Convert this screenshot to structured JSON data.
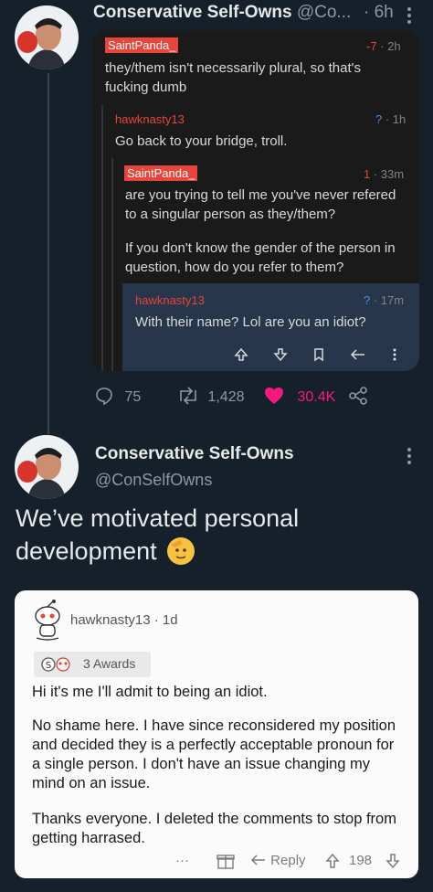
{
  "tweet1": {
    "display_name": "Conservative Self-Owns",
    "handle_truncated": "@Co...",
    "time": "· 6h",
    "avatar_icon": "profile-avatar"
  },
  "reddit_thread": {
    "comments": [
      {
        "user": "SaintPanda_",
        "score": "-7",
        "age": "· 2h",
        "text": "they/them isn't necessarily plural, so that's fucking dumb"
      },
      {
        "user": "hawknasty13",
        "score": "?",
        "age": "· 1h",
        "text": "Go back to your bridge, troll."
      },
      {
        "user": "SaintPanda_",
        "score": "1",
        "age": "· 33m",
        "text": "are you trying to tell me you've never refered to a singular person as they/them?",
        "text2": "If you don't know the gender of the person in question, how do you refer to them?"
      },
      {
        "user": "hawknasty13",
        "score": "?",
        "age": "· 17m",
        "text": "With their name? Lol are you an idiot?"
      }
    ],
    "action_icons": [
      "upvote-icon",
      "downvote-icon",
      "bookmark-icon",
      "reply-icon",
      "more-icon"
    ]
  },
  "tweet1_stats": {
    "replies": "75",
    "retweets": "1,428",
    "likes": "30.4K"
  },
  "tweet2": {
    "display_name": "Conservative Self-Owns",
    "handle": "@ConSelfOwns",
    "body": "We’ve motivated personal development"
  },
  "reddit_card": {
    "user": "hawknasty13",
    "age": "· 1d",
    "awards": "3 Awards",
    "paragraphs": [
      "Hi it's me I'll admit to being an idiot.",
      "No shame here. I have since reconsidered my position and decided they is a perfectly acceptable pronoun for a single person. I don't have an issue changing my mind on an issue.",
      "Thanks everyone. I deleted the comments to stop from getting harrased."
    ],
    "more": "···",
    "reply": "Reply",
    "score": "198"
  },
  "colors": {
    "background": "#15202b",
    "reddit_username": "#e8443a",
    "like_pink": "#f91880"
  }
}
